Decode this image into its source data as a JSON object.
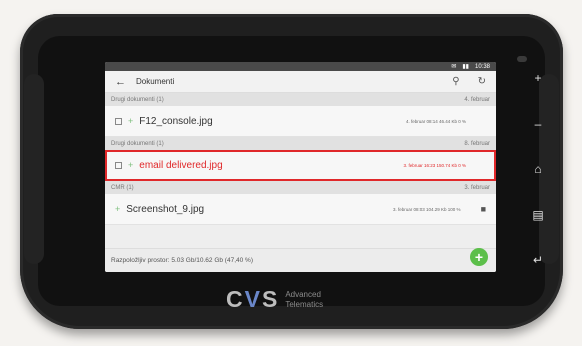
{
  "status": {
    "time": "10:38",
    "indicators": [
      "✉",
      "▮▮"
    ]
  },
  "appbar": {
    "back_icon": "←",
    "title": "Dokumenti",
    "search_icon": "🔍",
    "sync_icon": "↻"
  },
  "sections": [
    {
      "label": "Drugi dokumenti (1)",
      "date": "4. februar"
    },
    {
      "label": "Drugi dokumenti (1)",
      "date": "8. februar"
    },
    {
      "label": "CMR (1)",
      "date": "3. februar"
    }
  ],
  "rows": [
    {
      "name": "F12_console.jpg",
      "meta": "4. februar 08:14  46.44 Kb  0 %"
    },
    {
      "name": "email delivered.jpg",
      "meta": "3. februar 16:23  150.74 Kb  0 %"
    },
    {
      "name": "Screenshot_9.jpg",
      "meta": "3. februar 08:03  104.29 Kb  100 %"
    }
  ],
  "footer": {
    "storage": "Razpoložljiv prostor: 5.03 Gb/10.62 Gb (47,40 %)"
  },
  "fab": {
    "label": "+"
  },
  "sidekeys": [
    "+",
    "–",
    "⌂",
    "▤",
    "↵"
  ],
  "brand": {
    "logo_c": "C",
    "logo_v": "V",
    "logo_s": "S",
    "line1": "Advanced",
    "line2": "Telematics"
  },
  "colors": {
    "highlight": "#e0282a",
    "fab": "#5cbf4a",
    "accent": "#6a87c9"
  }
}
